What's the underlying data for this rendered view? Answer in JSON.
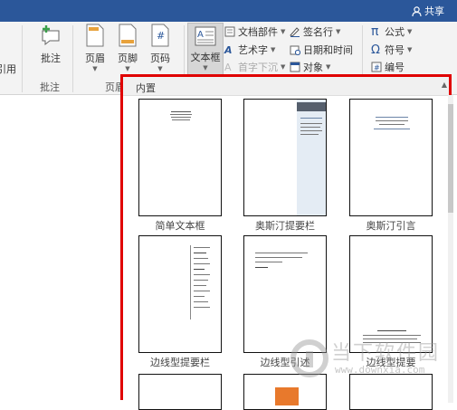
{
  "titlebar": {
    "share_label": "共享"
  },
  "ribbon": {
    "partial_left_label": "引用",
    "buttons": {
      "comment": "批注",
      "header": "页眉",
      "footer": "页脚",
      "page_number": "页码",
      "textbox": "文本框"
    },
    "groups": {
      "comments": "批注",
      "header_footer": "页眉"
    },
    "text_items": {
      "quick_parts": "文档部件",
      "wordart": "艺术字",
      "dropcap": "首字下沉",
      "signature_line": "签名行",
      "date_time": "日期和时间",
      "object": "对象"
    },
    "symbols": {
      "equation": "公式",
      "symbol": "符号",
      "number": "编号"
    }
  },
  "gallery": {
    "header": "内置",
    "items": [
      {
        "label": "简单文本框"
      },
      {
        "label": "奥斯汀提要栏"
      },
      {
        "label": "奥斯汀引言"
      },
      {
        "label": "边线型提要栏"
      },
      {
        "label": "边线型引述"
      },
      {
        "label": "边线型提要"
      }
    ]
  },
  "watermark": {
    "text": "当下软件园",
    "url": "www.downxia.com"
  },
  "colors": {
    "titlebar": "#2b579a",
    "highlight_border": "#e00000"
  }
}
